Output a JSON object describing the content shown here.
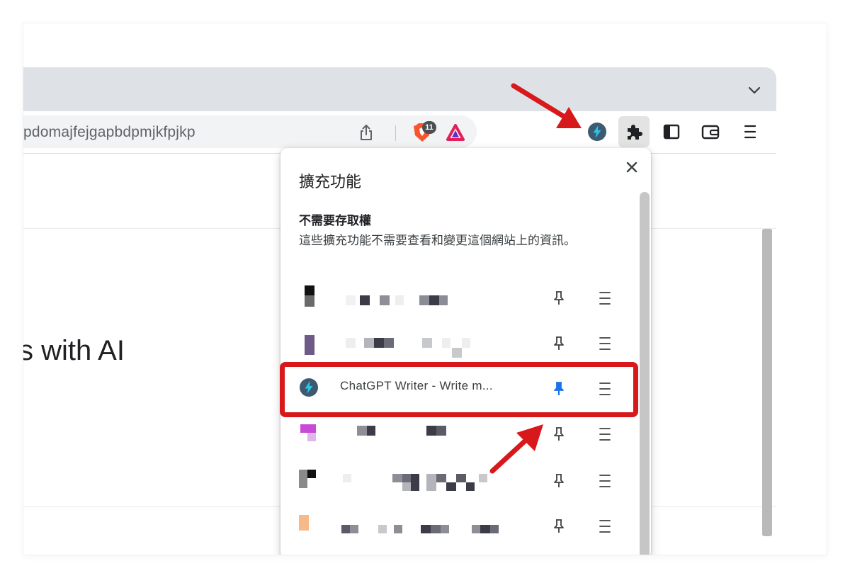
{
  "browser": {
    "url_text": "pdomajfejgapbdpmjkfpjkp",
    "brave_shield_count": "11"
  },
  "page": {
    "hero_text": "s with AI"
  },
  "extensions_popup": {
    "title": "擴充功能",
    "section_title": "不需要存取權",
    "section_description": "這些擴充功能不需要查看和變更這個網站上的資訊。",
    "items": [
      {
        "name": "",
        "pinned": false,
        "obscured": true
      },
      {
        "name": "",
        "pinned": false,
        "obscured": true
      },
      {
        "name": "ChatGPT Writer - Write m...",
        "pinned": true,
        "obscured": false
      },
      {
        "name": "",
        "pinned": false,
        "obscured": true
      },
      {
        "name": "",
        "pinned": false,
        "obscured": true
      },
      {
        "name": "",
        "pinned": false,
        "obscured": true
      }
    ]
  },
  "colors": {
    "annotation_red": "#d7191c",
    "pin_active": "#1a73e8",
    "chatgpt_writer_icon_bg": "#3d5a70",
    "chatgpt_writer_bolt": "#2ec4e6"
  },
  "icons": {
    "tab_search": "chevron-down-icon",
    "share": "share-icon",
    "brave": "brave-shield-icon",
    "brave_rewards": "brave-rewards-icon",
    "chatgpt_writer": "chatgpt-writer-icon",
    "extensions": "puzzle-icon",
    "sidebar": "sidebar-icon",
    "wallet": "wallet-icon",
    "menu": "hamburger-menu-icon",
    "close": "close-icon",
    "pin": "pin-icon"
  }
}
